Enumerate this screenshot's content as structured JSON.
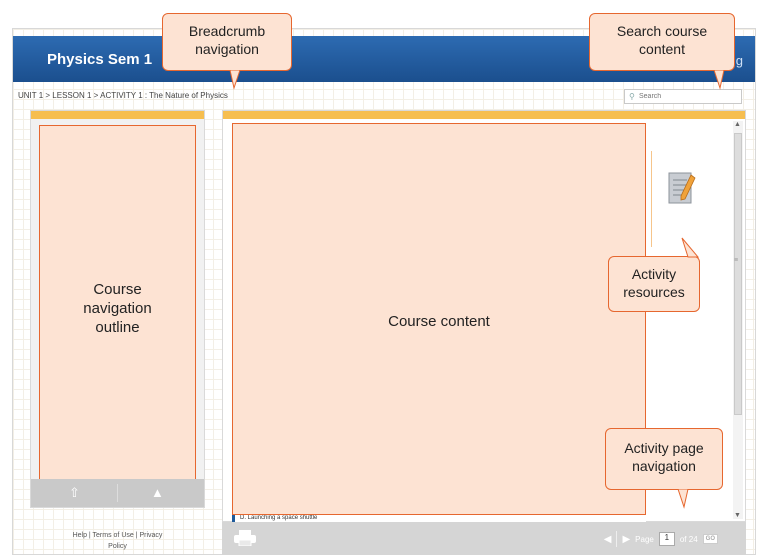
{
  "app": {
    "course_title": "Physics Sem 1",
    "brand_fragment": "g",
    "breadcrumb": "UNIT 1 > LESSON 1 > ACTIVITY 1 : The Nature of Physics"
  },
  "search": {
    "placeholder": "Search",
    "icon": "search-icon"
  },
  "left_panel": {
    "outline_label": "Course\nnavigation\noutline",
    "nav_prev_icon": "arrow-up-icon",
    "nav_next_icon": "arrow-up-icon"
  },
  "footer": {
    "links": "Help | Terms of Use | Privacy\nPolicy"
  },
  "main": {
    "content_label": "Course content",
    "content_snippet": "D. Launching a space shuttle"
  },
  "pager": {
    "page_label": "Page",
    "current_page": "1",
    "of_total": "of 24",
    "go_label": "GO"
  },
  "callouts": {
    "breadcrumb": "Breadcrumb\nnavigation",
    "search": "Search course\ncontent",
    "resources": "Activity\nresources",
    "pagenav": "Activity page\nnavigation"
  },
  "colors": {
    "header_blue": "#1b4f8e",
    "accent_orange": "#f6be4f",
    "callout_fill": "#fde3d3",
    "callout_border": "#e6672f"
  }
}
